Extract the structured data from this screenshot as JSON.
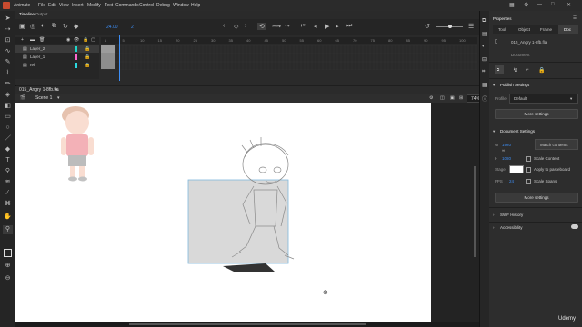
{
  "menubar": {
    "app": "Animate",
    "items": [
      "File",
      "Edit",
      "View",
      "Insert",
      "Modify",
      "Text",
      "Commands",
      "Control",
      "Debug",
      "Window",
      "Help"
    ]
  },
  "timeline": {
    "tabs": [
      "Timeline",
      "Output"
    ],
    "fps": "24.00",
    "frame": "2",
    "layers": [
      {
        "name": "Layer_2",
        "color": "#1fd6c8"
      },
      {
        "name": "Layer_1",
        "color": "#ff66cc"
      },
      {
        "name": "ref",
        "color": "#2bd9e0"
      }
    ],
    "ruler_ticks": [
      "1",
      "5",
      "10",
      "15",
      "20",
      "25",
      "30",
      "35",
      "40",
      "45",
      "50",
      "55",
      "60",
      "65",
      "70",
      "75",
      "80",
      "85",
      "90",
      "95",
      "100"
    ]
  },
  "document": {
    "filename": "015_Angry 1-8fb.fla",
    "scene": "Scene 1",
    "zoom": "74%"
  },
  "properties": {
    "title": "Properties",
    "tabs": [
      "Tool",
      "Object",
      "Frame",
      "Doc"
    ],
    "file": "015_Angry 1-8fb.fla",
    "type": "Document",
    "publish": {
      "header": "Publish Settings",
      "profile_label": "Profile",
      "profile_value": "Default",
      "more": "More settings"
    },
    "doc_settings": {
      "header": "Document Settings",
      "w_label": "W",
      "w_value": "1920",
      "h_label": "H",
      "h_value": "1080",
      "match_contents": "Match contents",
      "scale_content": "Scale Content",
      "stage_label": "Stage",
      "apply_to_pasteboard": "Apply to pasteboard",
      "fps_label": "FPS",
      "fps_value": "24",
      "scale_spans": "Scale Spans",
      "more": "More settings"
    },
    "swf_history": "SWF History",
    "accessibility": "Accessibility"
  },
  "watermark": "Udemy",
  "colors": {
    "accent": "#3d8ef5",
    "stage": "#ffffff",
    "selection": "#9ec9e6"
  }
}
